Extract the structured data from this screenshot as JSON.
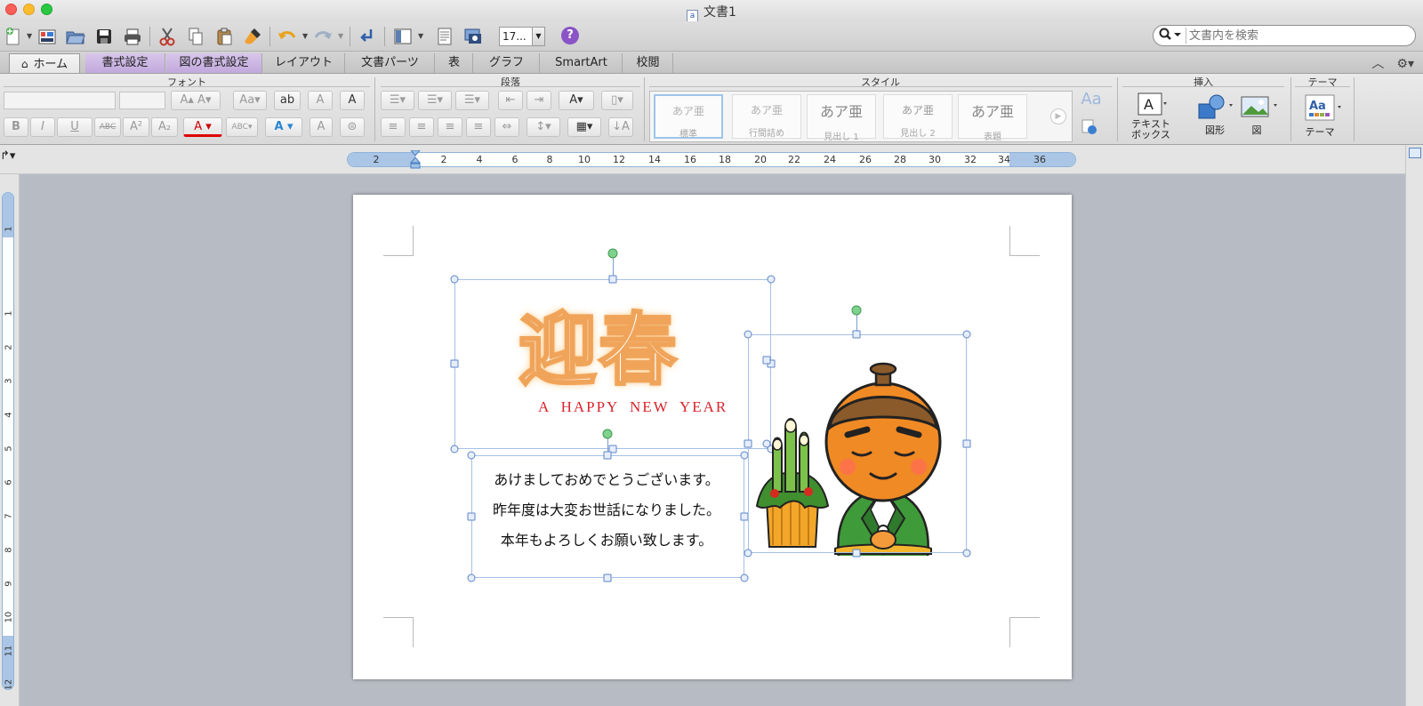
{
  "window": {
    "title": "文書1"
  },
  "toolbar": {
    "zoom_value": "17...",
    "help": "?",
    "search_placeholder": "文書内を検索"
  },
  "tabs": [
    {
      "label": "ホーム"
    },
    {
      "label": "書式設定"
    },
    {
      "label": "図の書式設定"
    },
    {
      "label": "レイアウト"
    },
    {
      "label": "文書パーツ"
    },
    {
      "label": "表"
    },
    {
      "label": "グラフ"
    },
    {
      "label": "SmartArt"
    },
    {
      "label": "校閲"
    }
  ],
  "ribbon": {
    "groups": {
      "font": "フォント",
      "paragraph": "段落",
      "style": "スタイル",
      "insert": "挿入",
      "theme": "テーマ"
    },
    "font_buttons": {
      "bold": "B",
      "italic": "I",
      "underline": "U",
      "strike": "ABC",
      "sup": "A²",
      "sub": "A₂",
      "color": "A"
    },
    "styles": [
      {
        "preview": "あア亜",
        "name": "標準"
      },
      {
        "preview": "あア亜",
        "name": "行間詰め"
      },
      {
        "preview": "あア亜",
        "name": "見出し 1"
      },
      {
        "preview": "あア亜",
        "name": "見出し 2"
      },
      {
        "preview": "あア亜",
        "name": "表題"
      }
    ],
    "insert": {
      "textbox": "テキスト\nボックス",
      "textbox_line1": "テキスト",
      "textbox_line2": "ボックス",
      "shape": "図形",
      "picture": "図"
    },
    "theme": {
      "label": "テーマ",
      "preview": "Aa"
    }
  },
  "ruler": {
    "horizontal": [
      "2",
      "2",
      "4",
      "6",
      "8",
      "10",
      "12",
      "14",
      "16",
      "18",
      "20",
      "22",
      "24",
      "26",
      "28",
      "30",
      "32",
      "34",
      "36"
    ],
    "vertical": [
      "1",
      "1",
      "2",
      "3",
      "4",
      "5",
      "6",
      "7",
      "8",
      "9",
      "10",
      "11",
      "12"
    ]
  },
  "document": {
    "headline": "迎春",
    "subtitle": "A HAPPY NEW YEAR",
    "greeting": [
      "あけましておめでとうございます。",
      "昨年度は大変お世話になりました。",
      "本年もよろしくお願い致します。"
    ]
  },
  "colors": {
    "headline_outline": "#f0a45a",
    "subtitle": "#d8242b",
    "tab_highlight": "#c8b0e0"
  },
  "icons": {
    "new": "new-document-icon",
    "gallery": "gallery-icon",
    "open": "open-icon",
    "save": "save-icon",
    "print": "print-icon",
    "cut": "scissors-icon",
    "copy": "copy-icon",
    "paste": "paste-icon",
    "format_painter": "brush-icon",
    "undo": "undo-icon",
    "redo": "redo-icon"
  }
}
